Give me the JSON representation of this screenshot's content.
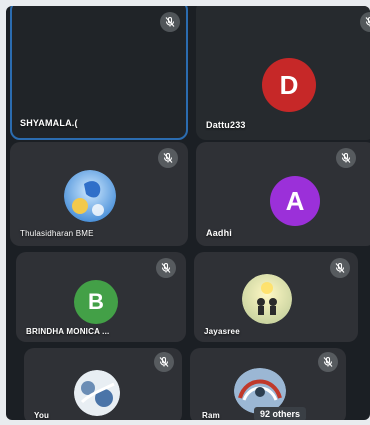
{
  "participants": [
    {
      "name": "SHYAMALA.(",
      "avatar_type": "none",
      "muted": true
    },
    {
      "name": "Dattu233",
      "avatar_type": "letter",
      "letter": "D",
      "avatar_color": "#c62828",
      "muted": true
    },
    {
      "name": "Thulasidharan BME",
      "avatar_type": "photo",
      "muted": true
    },
    {
      "name": "Aadhi",
      "avatar_type": "letter",
      "letter": "A",
      "avatar_color": "#9b30d9",
      "muted": true
    },
    {
      "name": "BRINDHA MONICA ...",
      "avatar_type": "letter",
      "letter": "B",
      "avatar_color": "#43a047",
      "muted": true
    },
    {
      "name": "Jayasree",
      "avatar_type": "photo",
      "muted": true
    },
    {
      "name": "You",
      "avatar_type": "photo",
      "muted": true
    },
    {
      "name": "Ram",
      "avatar_type": "photo",
      "muted": true
    }
  ],
  "others_label": "92 others",
  "colors": {
    "active_speaker_border": "#2b6cb0",
    "tile_background": "#2f3136"
  }
}
